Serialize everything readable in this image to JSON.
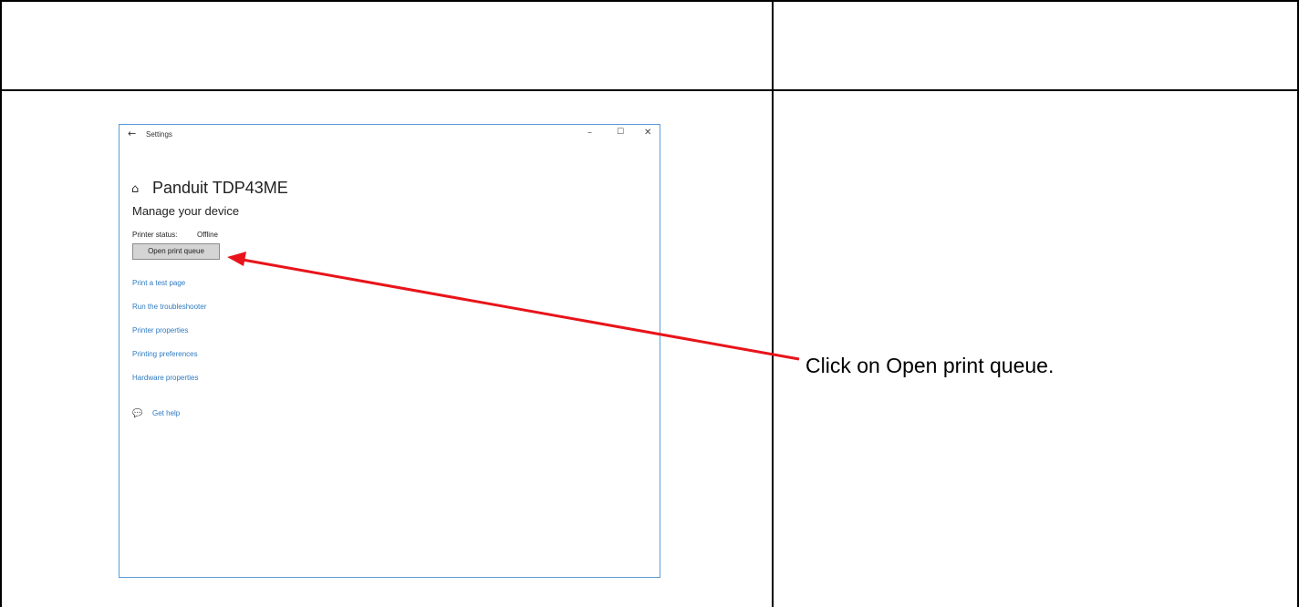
{
  "instruction": {
    "text": "Click on Open print queue."
  },
  "window": {
    "app_title": "Settings",
    "controls": {
      "minimize": "–",
      "maximize": "☐",
      "close": "✕"
    },
    "page_title": "Panduit TDP43ME",
    "section_title": "Manage your device",
    "printer_status_label": "Printer status:",
    "printer_status_value": "Offline",
    "open_queue_button": "Open print queue",
    "links": [
      "Print a test page",
      "Run the troubleshooter",
      "Printer properties",
      "Printing preferences",
      "Hardware properties"
    ],
    "get_help": "Get help"
  },
  "annotation": {
    "arrow_color": "#e8141a"
  }
}
